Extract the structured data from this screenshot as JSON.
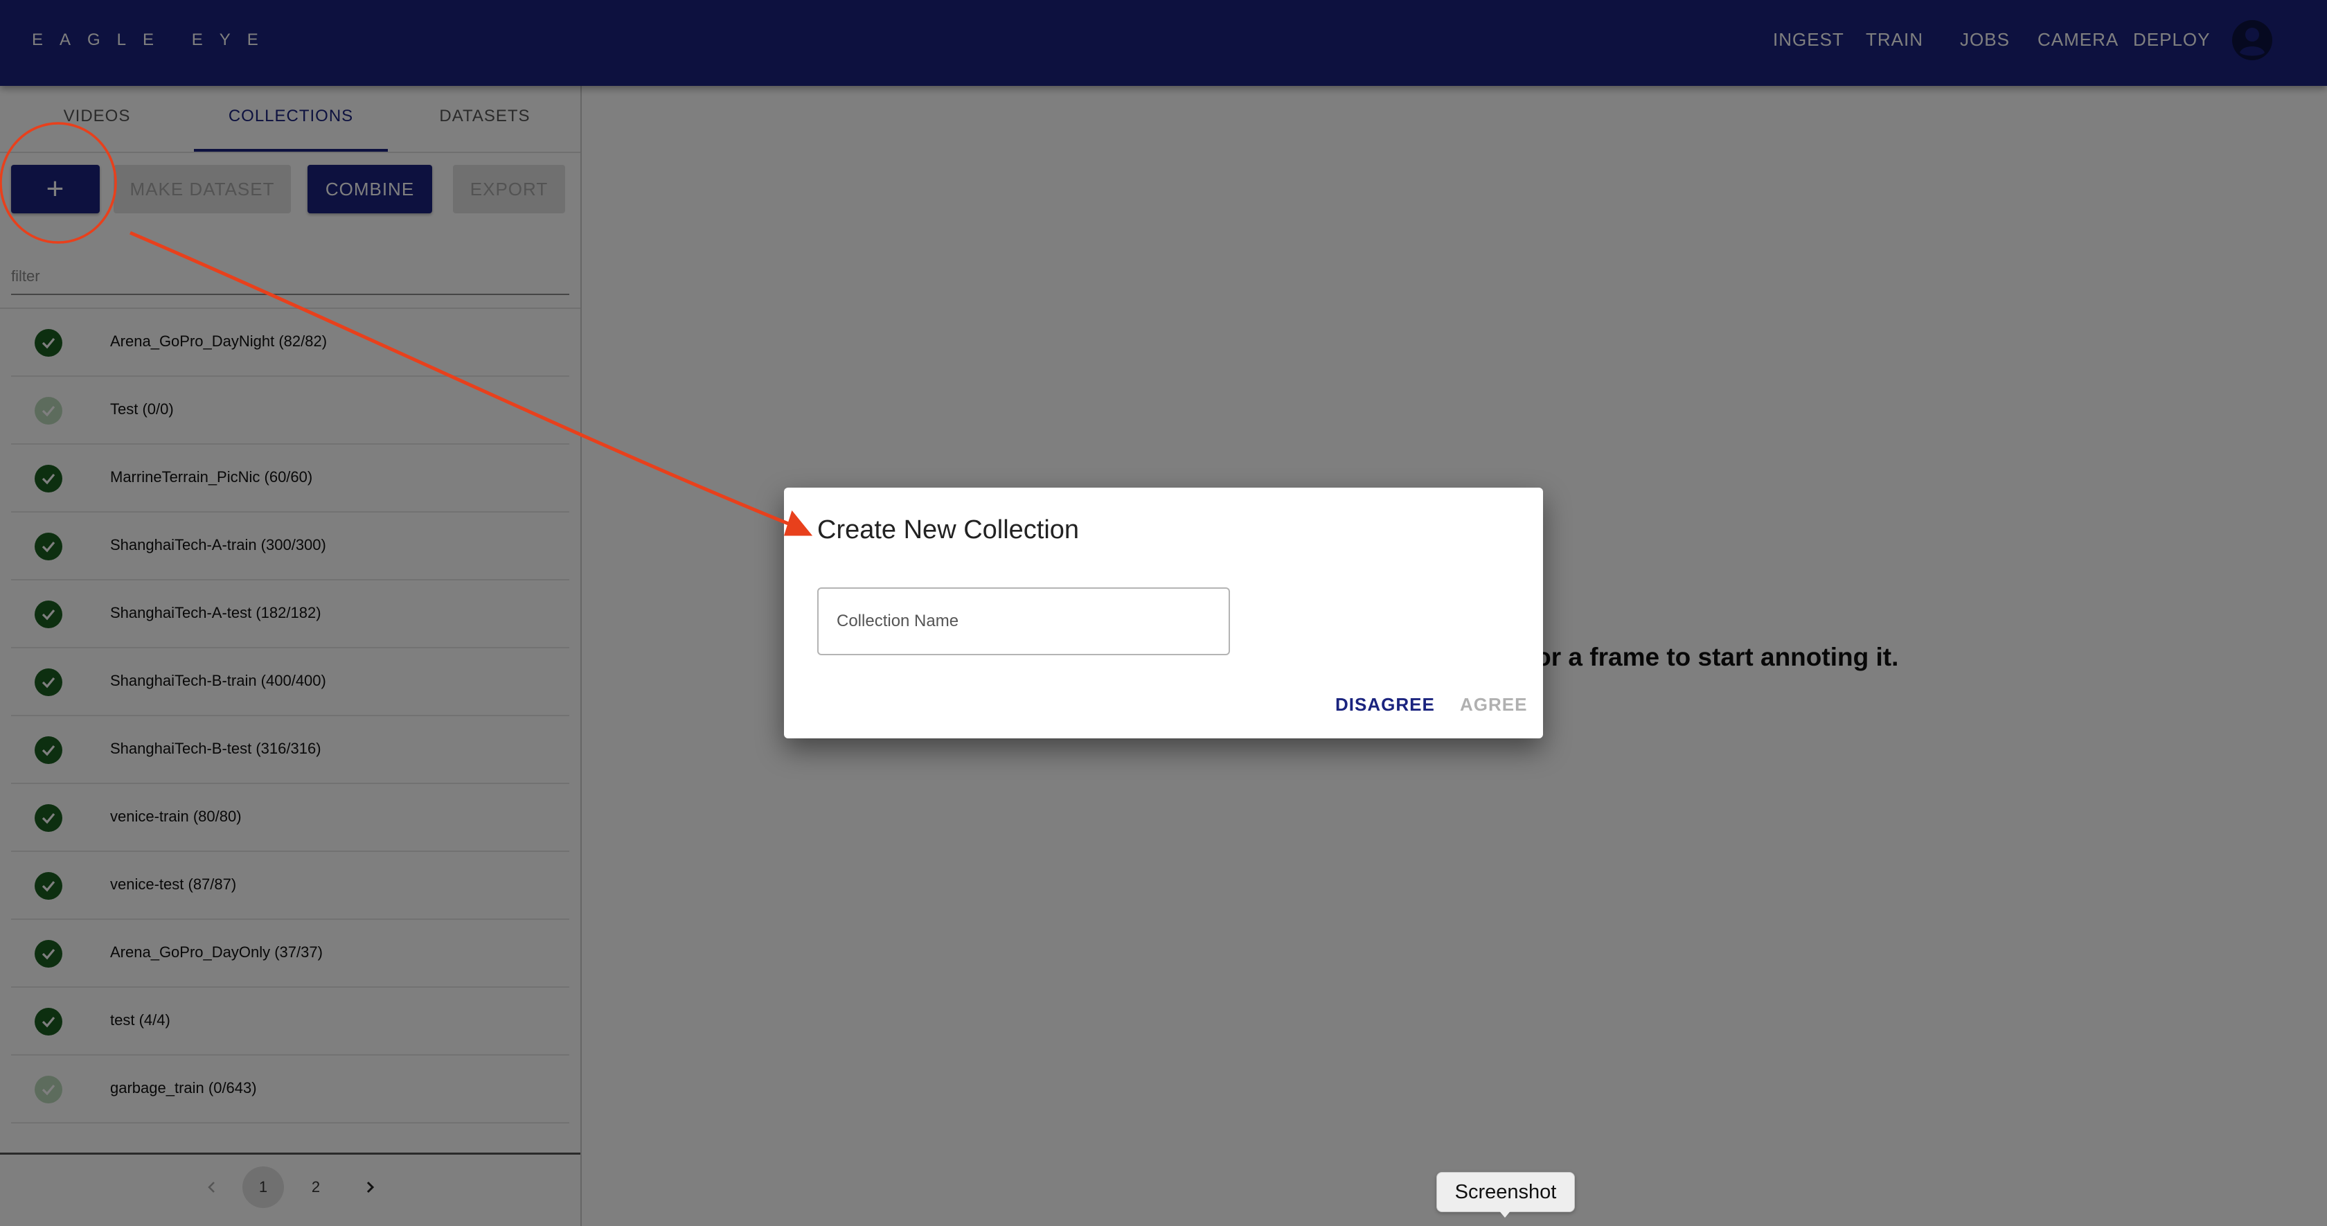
{
  "app": {
    "brand": "EAGLE EYE",
    "nav": [
      "INGEST",
      "TRAIN",
      "JOBS",
      "CAMERA",
      "DEPLOY"
    ]
  },
  "left_panel": {
    "tabs": [
      "VIDEOS",
      "COLLECTIONS",
      "DATASETS"
    ],
    "active_tab": "COLLECTIONS",
    "buttons": {
      "add": "+",
      "make_dataset": "MAKE DATASET",
      "combine": "COMBINE",
      "export": "EXPORT"
    },
    "filter_placeholder": "filter",
    "collections": [
      {
        "label": "Arena_GoPro_DayNight (82/82)",
        "complete": true
      },
      {
        "label": "Test (0/0)",
        "complete": false
      },
      {
        "label": "MarrineTerrain_PicNic (60/60)",
        "complete": true
      },
      {
        "label": "ShanghaiTech-A-train (300/300)",
        "complete": true
      },
      {
        "label": "ShanghaiTech-A-test (182/182)",
        "complete": true
      },
      {
        "label": "ShanghaiTech-B-train (400/400)",
        "complete": true
      },
      {
        "label": "ShanghaiTech-B-test (316/316)",
        "complete": true
      },
      {
        "label": "venice-train (80/80)",
        "complete": true
      },
      {
        "label": "venice-test (87/87)",
        "complete": true
      },
      {
        "label": "Arena_GoPro_DayOnly (37/37)",
        "complete": true
      },
      {
        "label": "test (4/4)",
        "complete": true
      },
      {
        "label": "garbage_train (0/643)",
        "complete": false
      }
    ],
    "pagination": {
      "pages": [
        "1",
        "2"
      ],
      "current": "1"
    }
  },
  "main": {
    "message_visible": "s, or a frame to start annoting it."
  },
  "dialog": {
    "title": "Create New Collection",
    "input_placeholder": "Collection Name",
    "disagree": "DISAGREE",
    "agree": "AGREE"
  },
  "tooltip": {
    "text": "Screenshot"
  },
  "colors": {
    "appbar": "#1a237e",
    "primary": "#1a237e",
    "check_complete": "#1b5e20",
    "annotation": "#e8401c"
  }
}
